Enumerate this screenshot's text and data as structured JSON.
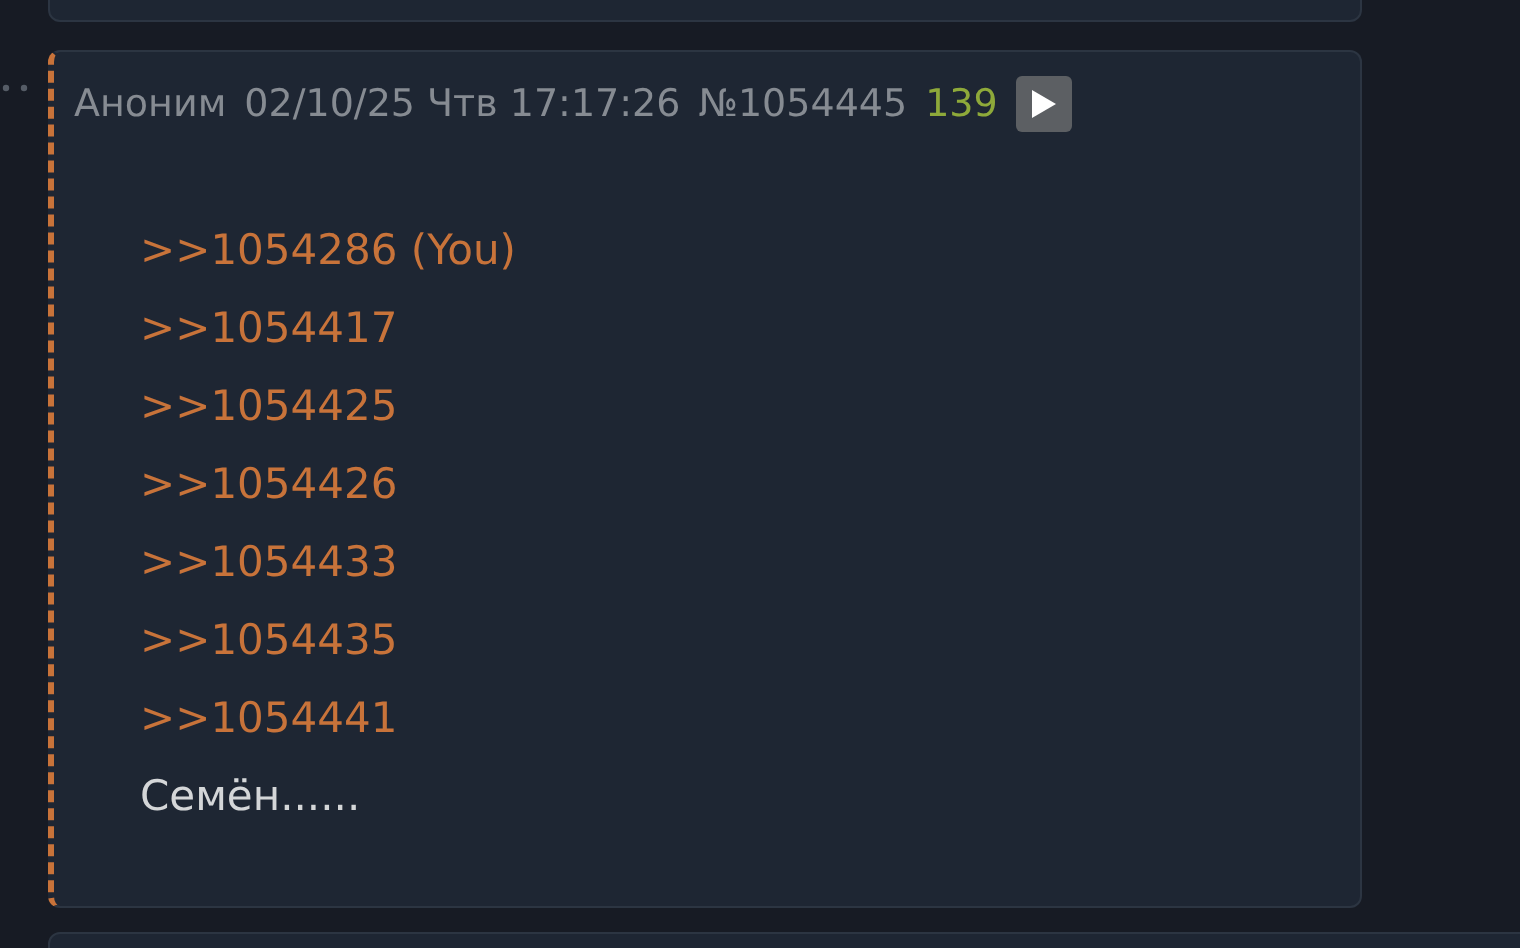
{
  "post": {
    "author": "Аноним",
    "date": "02/10/25 Чтв 17:17:26",
    "number": "№1054445",
    "count": "139",
    "replies": [
      {
        "text": ">>1054286 (You)"
      },
      {
        "text": ">>1054417"
      },
      {
        "text": ">>1054425"
      },
      {
        "text": ">>1054426"
      },
      {
        "text": ">>1054433"
      },
      {
        "text": ">>1054435"
      },
      {
        "text": ">>1054441"
      }
    ],
    "message": "Семён......"
  }
}
